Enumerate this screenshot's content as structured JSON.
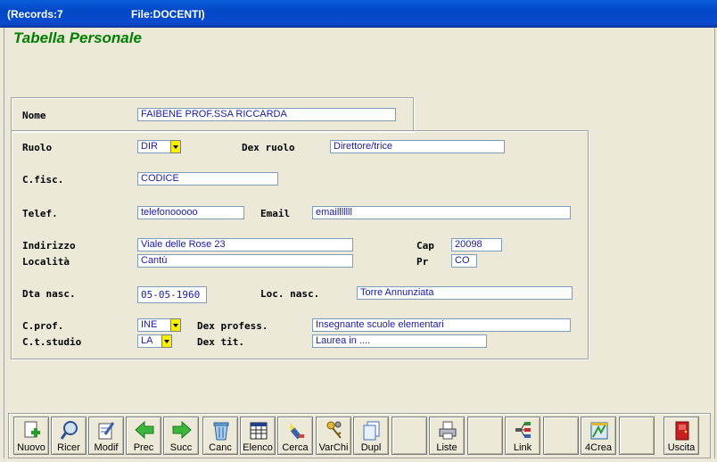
{
  "titlebar": {
    "records": "(Records:7",
    "file": "File:DOCENTI)"
  },
  "heading": "Tabella Personale",
  "nome": {
    "label": "Nome",
    "value": "FAIBENE PROF.SSA RICCARDA"
  },
  "ruolo": {
    "label": "Ruolo",
    "value": "DIR"
  },
  "dex_ruolo": {
    "label": "Dex ruolo",
    "value": "Direttore/trice"
  },
  "cfisc": {
    "label": "C.fisc.",
    "value": "CODICE"
  },
  "telef": {
    "label": "Telef.",
    "value": "telefonooooo"
  },
  "email": {
    "label": "Email",
    "value": "emailllllll"
  },
  "indirizzo": {
    "label": "Indirizzo",
    "value": "Viale delle Rose 23"
  },
  "cap": {
    "label": "Cap",
    "value": "20098"
  },
  "localita": {
    "label": "Località",
    "value": "Cantù"
  },
  "pr": {
    "label": "Pr",
    "value": "CO"
  },
  "dta_nasc": {
    "label": "Dta nasc.",
    "value": "05-05-1960"
  },
  "loc_nasc": {
    "label": "Loc. nasc.",
    "value": "Torre Annunziata"
  },
  "cprof": {
    "label": "C.prof.",
    "value": "INE"
  },
  "dex_profess": {
    "label": "Dex profess.",
    "value": "Insegnante scuole elementari"
  },
  "ctstudio": {
    "label": "C.t.studio",
    "value": "LA"
  },
  "dex_tit": {
    "label": "Dex tit.",
    "value": "Laurea in ...."
  },
  "toolbar": [
    {
      "label": "Nuovo",
      "icon": "new-doc-icon"
    },
    {
      "label": "Ricer",
      "icon": "magnifier-icon"
    },
    {
      "label": "Modif",
      "icon": "edit-doc-icon"
    },
    {
      "label": "Prec",
      "icon": "arrow-left-icon"
    },
    {
      "label": "Succ",
      "icon": "arrow-right-icon"
    },
    {
      "label": "Canc",
      "icon": "trash-icon"
    },
    {
      "label": "Elenco",
      "icon": "table-icon"
    },
    {
      "label": "Cerca",
      "icon": "flashlight-icon"
    },
    {
      "label": "VarChi",
      "icon": "keys-icon"
    },
    {
      "label": "Dupl",
      "icon": "duplicate-icon"
    },
    {
      "label": "",
      "icon": ""
    },
    {
      "label": "Liste",
      "icon": "printer-icon"
    },
    {
      "label": "",
      "icon": ""
    },
    {
      "label": "Link",
      "icon": "link-tree-icon"
    },
    {
      "label": "",
      "icon": ""
    },
    {
      "label": "4Crea",
      "icon": "create-tool-icon"
    },
    {
      "label": "",
      "icon": ""
    },
    {
      "label": "Uscita",
      "icon": "exit-door-icon"
    }
  ],
  "colors": {
    "title_bar": "#0347c6",
    "heading": "#008000",
    "field_text": "#1a1aa0",
    "dropdown": "#f6f000"
  }
}
